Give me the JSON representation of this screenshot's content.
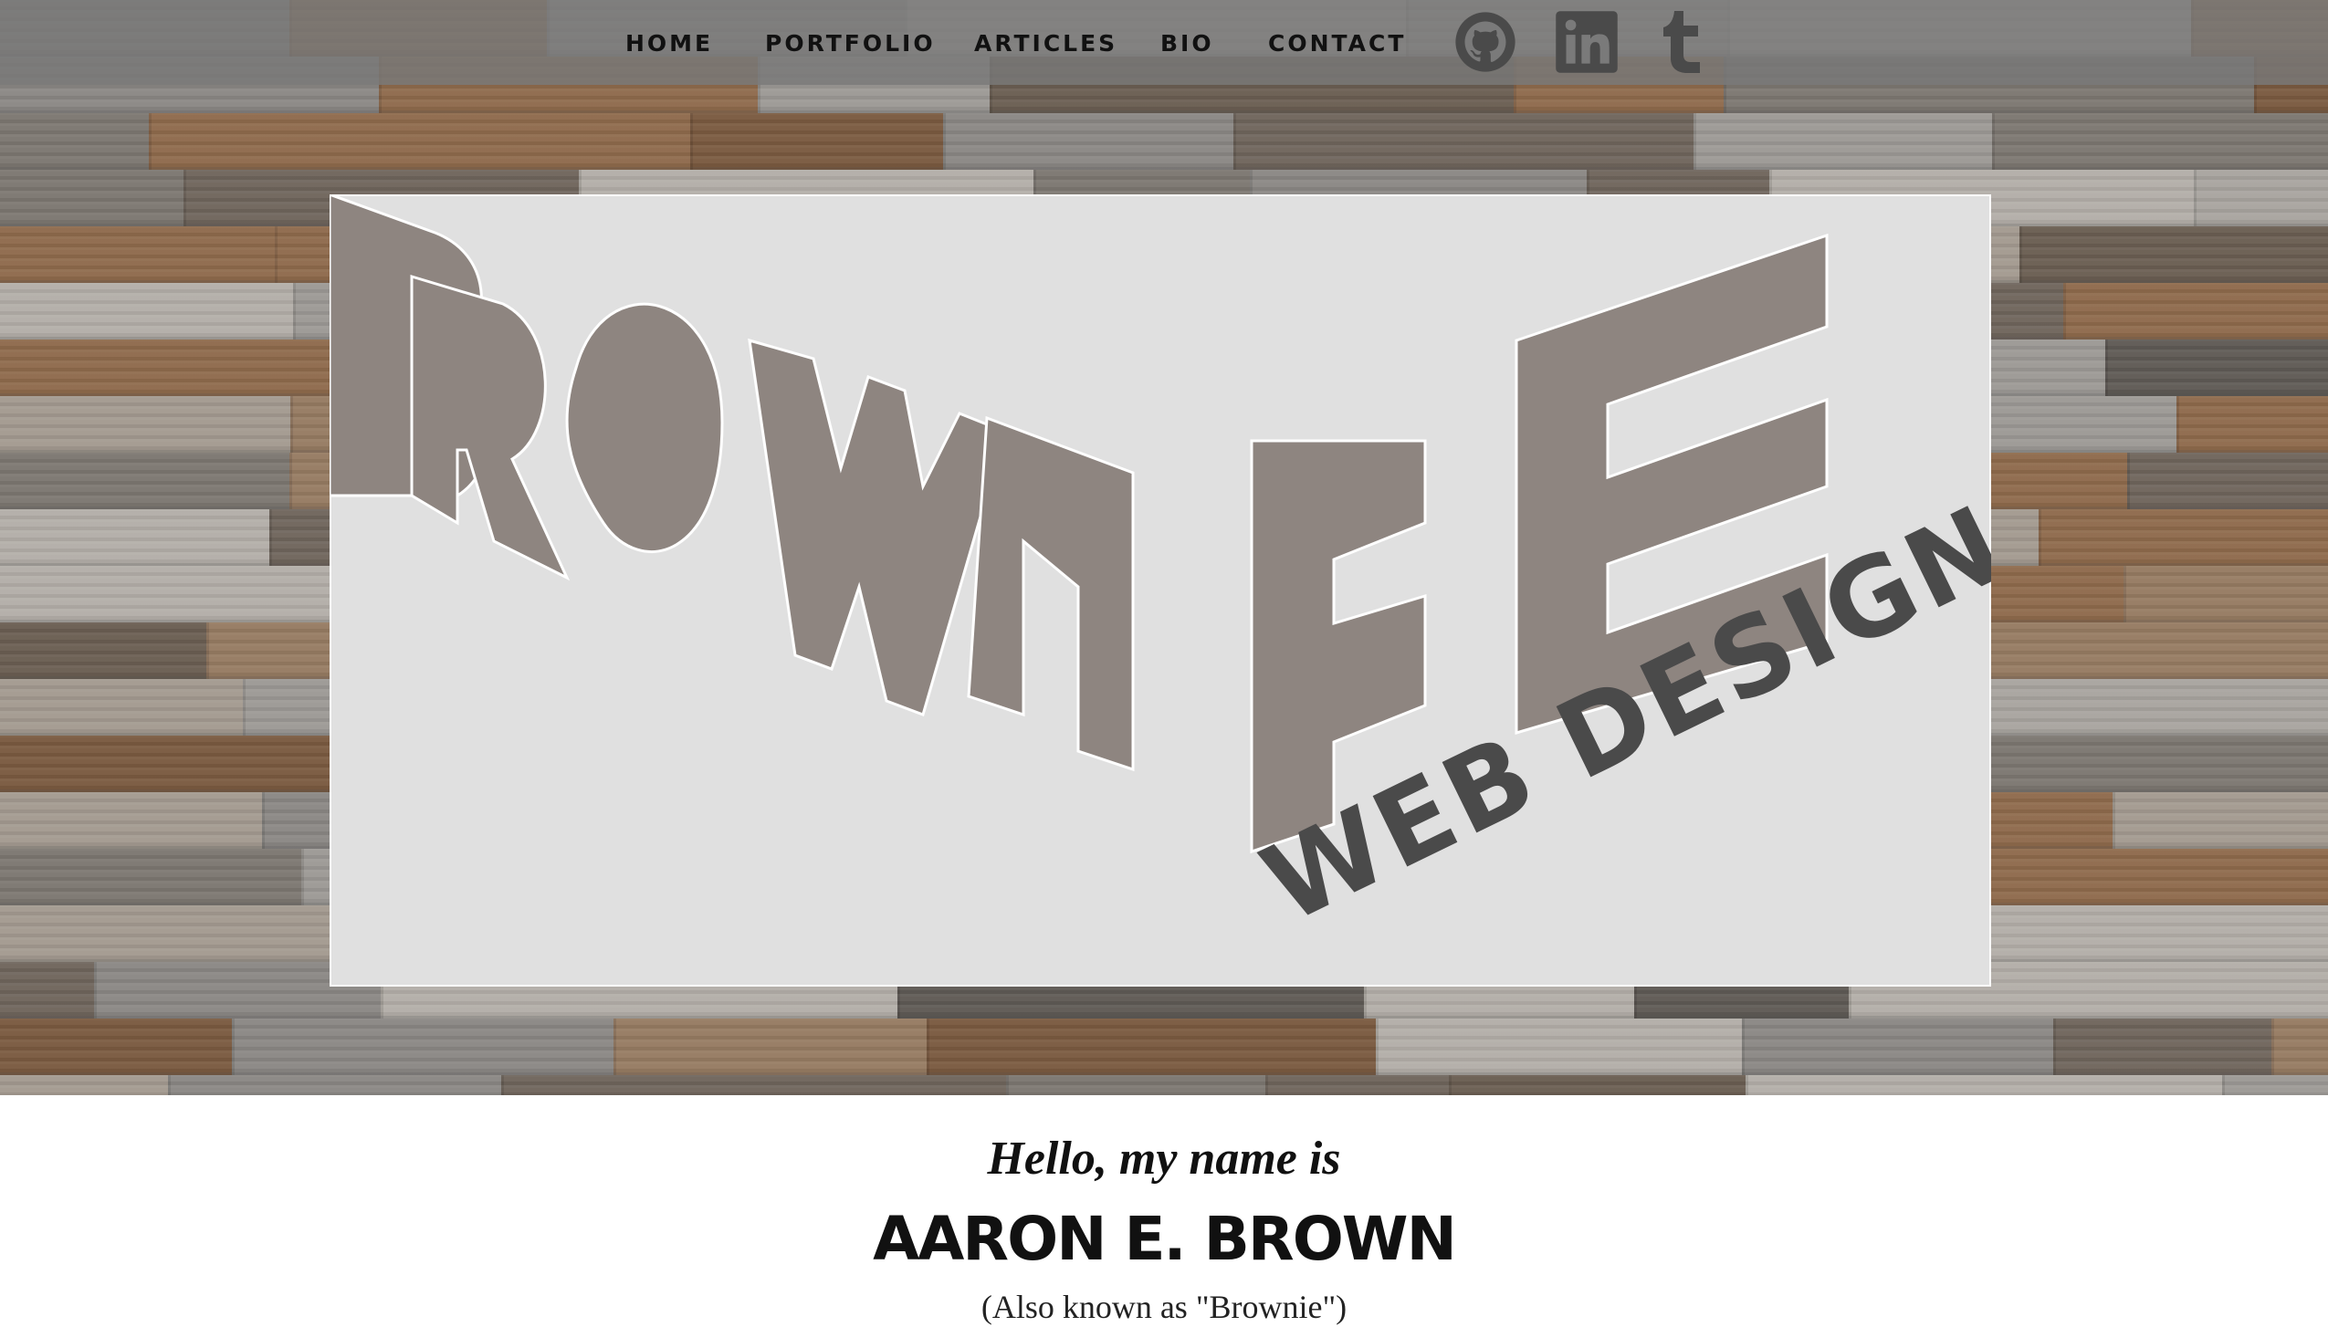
{
  "nav": {
    "items": [
      {
        "label": "HOME"
      },
      {
        "label": "PORTFOLIO"
      },
      {
        "label": "ARTICLES"
      },
      {
        "label": "BIO"
      },
      {
        "label": "CONTACT"
      }
    ],
    "social": [
      {
        "icon": "github-icon"
      },
      {
        "icon": "linkedin-icon"
      },
      {
        "icon": "tumblr-icon"
      }
    ]
  },
  "logo": {
    "name_text": "BROWN",
    "initial_text": "E",
    "tagline": "WEB DESIGN"
  },
  "intro": {
    "greeting": "Hello, my name is",
    "name": "AARON E. BROWN",
    "aka": "(Also known as \"Brownie\")"
  },
  "colors": {
    "navbar": "#787878",
    "panel": "#e0e0e0",
    "logo_text": "#4a4a4a",
    "text": "#111111"
  }
}
